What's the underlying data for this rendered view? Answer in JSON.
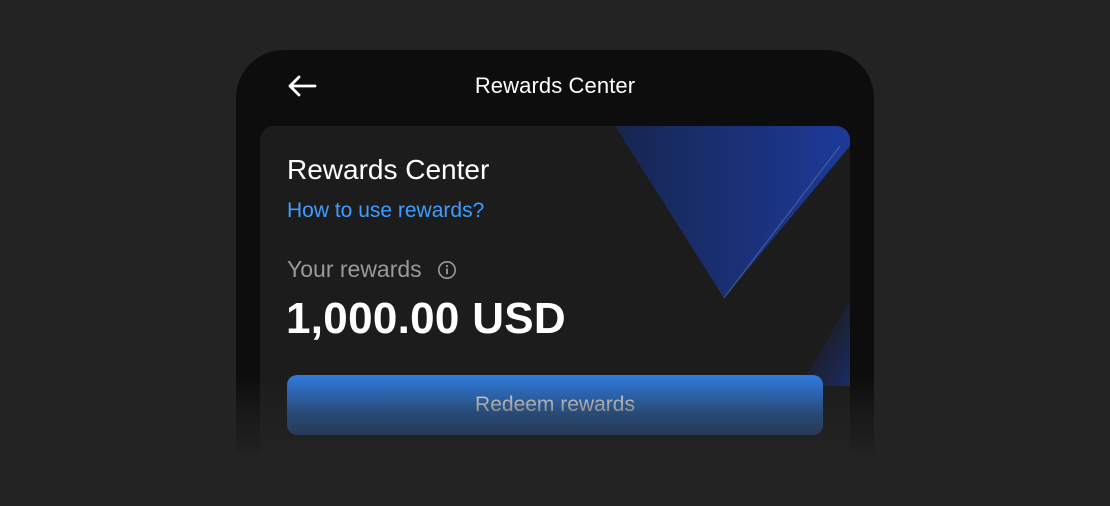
{
  "header": {
    "title": "Rewards Center",
    "back_icon": "arrow-left-icon"
  },
  "card": {
    "title": "Rewards Center",
    "help_link": "How to use rewards?",
    "rewards_label": "Your rewards",
    "info_icon": "info-circle-icon",
    "rewards_amount": "1,000.00 USD",
    "redeem_label": "Redeem rewards"
  },
  "colors": {
    "background": "#232323",
    "card": "#1c1c1c",
    "link": "#3f9dff",
    "button": "#2f78d6",
    "accent_decor": "#1d3a8f"
  }
}
